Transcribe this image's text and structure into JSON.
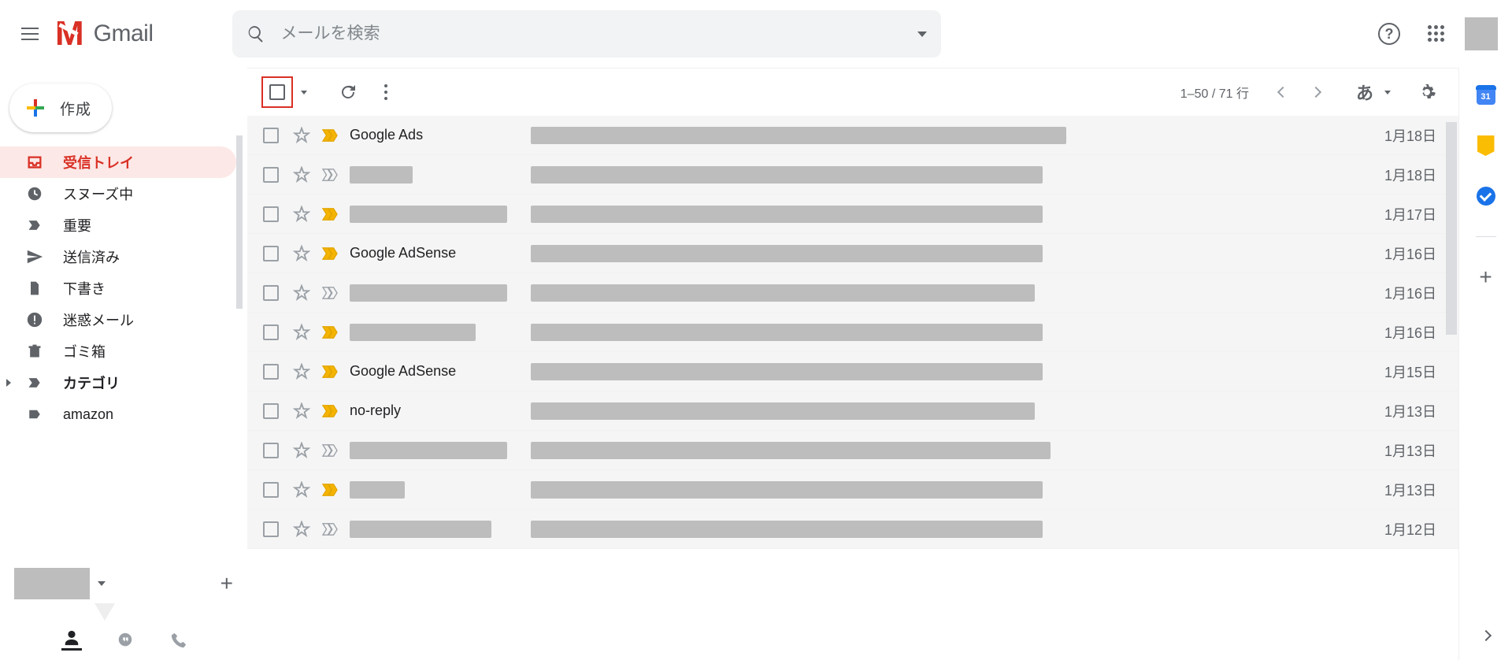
{
  "header": {
    "product": "Gmail",
    "search_placeholder": "メールを検索",
    "help_glyph": "?"
  },
  "compose_label": "作成",
  "sidebar": {
    "items": [
      {
        "id": "inbox",
        "label": "受信トレイ",
        "icon": "inbox",
        "active": true,
        "bold": true
      },
      {
        "id": "snoozed",
        "label": "スヌーズ中",
        "icon": "clock"
      },
      {
        "id": "important",
        "label": "重要",
        "icon": "important"
      },
      {
        "id": "sent",
        "label": "送信済み",
        "icon": "send"
      },
      {
        "id": "drafts",
        "label": "下書き",
        "icon": "file"
      },
      {
        "id": "spam",
        "label": "迷惑メール",
        "icon": "alert"
      },
      {
        "id": "trash",
        "label": "ゴミ箱",
        "icon": "trash"
      },
      {
        "id": "categories",
        "label": "カテゴリ",
        "icon": "tag",
        "bold": true,
        "expandable": true
      },
      {
        "id": "label-amazon",
        "label": "amazon",
        "icon": "label"
      }
    ]
  },
  "toolbar": {
    "count": "1–50 / 71 行",
    "ime": "あ"
  },
  "sidepanel": {
    "calendar_day": "31"
  },
  "emails": [
    {
      "sender": "Google Ads",
      "redactSender": false,
      "senderW": 0,
      "important": true,
      "date": "1月18日",
      "subjW": 680
    },
    {
      "sender": "",
      "redactSender": true,
      "senderW": 80,
      "important": false,
      "date": "1月18日",
      "subjW": 650
    },
    {
      "sender": "",
      "redactSender": true,
      "senderW": 220,
      "important": true,
      "date": "1月17日",
      "subjW": 650
    },
    {
      "sender": "Google AdSense",
      "redactSender": false,
      "senderW": 0,
      "important": true,
      "date": "1月16日",
      "subjW": 650
    },
    {
      "sender": "",
      "redactSender": true,
      "senderW": 200,
      "important": false,
      "date": "1月16日",
      "subjW": 640
    },
    {
      "sender": "",
      "redactSender": true,
      "senderW": 160,
      "important": true,
      "date": "1月16日",
      "subjW": 650
    },
    {
      "sender": "Google AdSense",
      "redactSender": false,
      "senderW": 0,
      "important": true,
      "date": "1月15日",
      "subjW": 650
    },
    {
      "sender": "no-reply",
      "redactSender": false,
      "senderW": 0,
      "important": true,
      "date": "1月13日",
      "subjW": 640
    },
    {
      "sender": "",
      "redactSender": true,
      "senderW": 200,
      "important": false,
      "date": "1月13日",
      "subjW": 660
    },
    {
      "sender": "",
      "redactSender": true,
      "senderW": 70,
      "important": true,
      "date": "1月13日",
      "subjW": 650
    },
    {
      "sender": "",
      "redactSender": true,
      "senderW": 180,
      "important": false,
      "date": "1月12日",
      "subjW": 650
    }
  ]
}
